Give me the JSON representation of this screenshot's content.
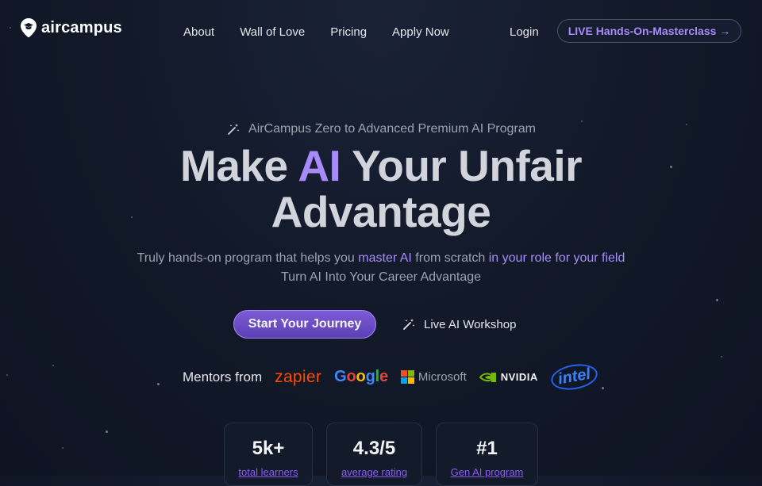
{
  "brand": {
    "name": "aircampus"
  },
  "nav": {
    "links": [
      "About",
      "Wall of Love",
      "Pricing",
      "Apply Now"
    ],
    "login": "Login",
    "cta": "LIVE Hands-On-Masterclass →"
  },
  "hero": {
    "eyebrow": "AirCampus Zero to Advanced Premium AI Program",
    "title_part1": "Make ",
    "title_highlight": "AI",
    "title_part2": " Your Unfair",
    "title_line2": "Advantage",
    "sub_part1": "Truly hands-on program that helps you ",
    "sub_hl1": "master AI",
    "sub_part2": " from scratch ",
    "sub_hl2": "in your role for your field",
    "sub_line2": "Turn AI Into Your Career Advantage"
  },
  "cta": {
    "primary": "Start Your Journey",
    "secondary": "Live AI Workshop"
  },
  "mentors": {
    "label": "Mentors from",
    "companies": [
      "zapier",
      "Google",
      "Microsoft",
      "NVIDIA",
      "intel"
    ]
  },
  "stats": [
    {
      "value": "5k+",
      "label": "total learners"
    },
    {
      "value": "4.3/5",
      "label": "average rating"
    },
    {
      "value": "#1",
      "label": "Gen AI program"
    }
  ],
  "colors": {
    "accent": "#a78bfa",
    "background": "#111827"
  }
}
